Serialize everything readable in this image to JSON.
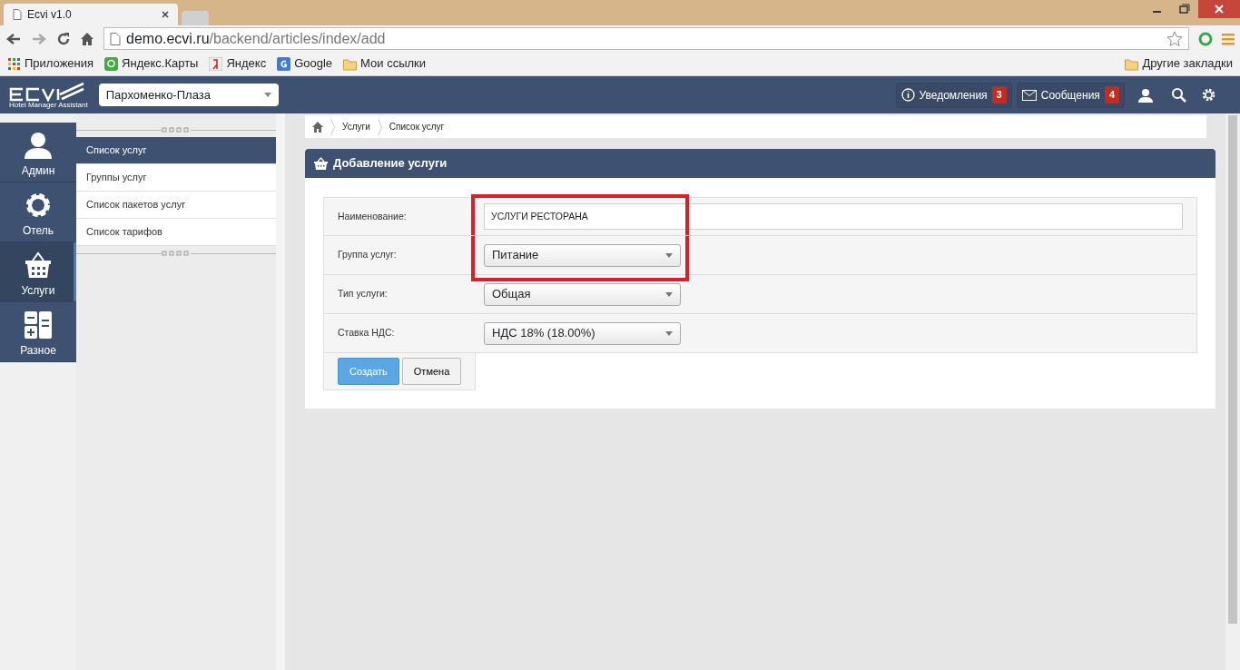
{
  "browser": {
    "tabs": [
      {
        "title": "Ecvi v1.0",
        "selected": true
      },
      {
        "selected": false
      }
    ],
    "url_host": "demo.ecvi.ru",
    "url_path": "/backend/articles/index/add",
    "bookmarks": [
      {
        "kind": "apps",
        "label": "Приложения"
      },
      {
        "kind": "maps",
        "label": "Яндекс.Карты"
      },
      {
        "kind": "yandex",
        "label": "Яндекс"
      },
      {
        "kind": "google",
        "label": "Google"
      },
      {
        "kind": "folder",
        "label": "Мои ссылки"
      }
    ],
    "other_bookmarks": "Другие закладки"
  },
  "navbar": {
    "logo_subtitle": "Hotel Manager Assistant",
    "hotel_select": "Пархоменко-Плаза",
    "notifications": {
      "label": "Уведомления",
      "count": "3"
    },
    "messages": {
      "label": "Сообщения",
      "count": "4"
    }
  },
  "sidebar": {
    "items": [
      {
        "kind": "user",
        "label": "Админ",
        "selected": false
      },
      {
        "kind": "gear",
        "label": "Отель",
        "selected": false
      },
      {
        "kind": "basket",
        "label": "Услуги",
        "selected": true
      },
      {
        "kind": "calc",
        "label": "Разное",
        "selected": false
      }
    ]
  },
  "submenu": {
    "items": [
      {
        "label": "Список услуг",
        "selected": true
      },
      {
        "label": "Группы услуг",
        "selected": false
      },
      {
        "label": "Список пакетов услуг",
        "selected": false
      },
      {
        "label": "Список тарифов",
        "selected": false
      }
    ]
  },
  "breadcrumb": [
    "Услуги",
    "Список услуг"
  ],
  "panel": {
    "title": "Добавление услуги",
    "fields": [
      {
        "kind": "text",
        "label": "Наименование:",
        "value": "УСЛУГИ РЕСТОРАНА",
        "highlighted": true
      },
      {
        "kind": "select",
        "label": "Группа услуг:",
        "value": "Питание",
        "highlighted": true
      },
      {
        "kind": "select",
        "label": "Тип услуги:",
        "value": "Общая",
        "highlighted": false
      },
      {
        "kind": "select",
        "label": "Ставка НДС:",
        "value": "НДС 18% (18.00%)",
        "highlighted": false
      }
    ],
    "buttons": [
      {
        "kind": "primary",
        "label": "Создать"
      },
      {
        "kind": "default",
        "label": "Отмена"
      }
    ]
  }
}
